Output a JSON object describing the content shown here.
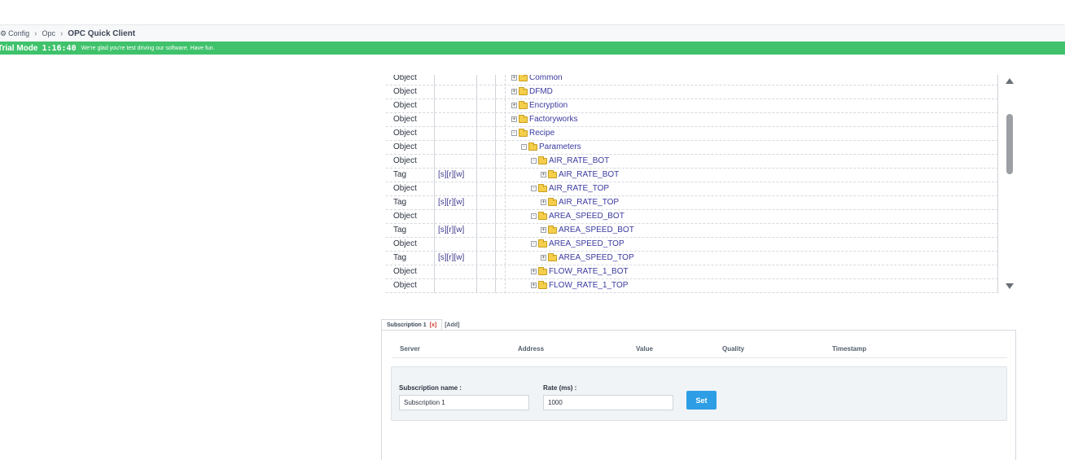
{
  "breadcrumb": {
    "items": [
      "Config",
      "Opc"
    ],
    "current": "OPC Quick Client"
  },
  "trial": {
    "mode": "Trial Mode",
    "time": "1:16:40",
    "message": "We're glad you're test driving our software. Have fun."
  },
  "tree": {
    "rows": [
      {
        "type": "Object",
        "access": "",
        "label": "Common",
        "expander": "+"
      },
      {
        "type": "Object",
        "access": "",
        "label": "DFMD",
        "expander": "+"
      },
      {
        "type": "Object",
        "access": "",
        "label": "Encryption",
        "expander": "+"
      },
      {
        "type": "Object",
        "access": "",
        "label": "Factoryworks",
        "expander": "+"
      },
      {
        "type": "Object",
        "access": "",
        "label": "Recipe",
        "expander": "-"
      },
      {
        "type": "Object",
        "access": "",
        "label": "Parameters",
        "expander": "-"
      },
      {
        "type": "Object",
        "access": "",
        "label": "AIR_RATE_BOT",
        "expander": "-"
      },
      {
        "type": "Tag",
        "access": "[s][r][w]",
        "label": "AIR_RATE_BOT",
        "expander": "+"
      },
      {
        "type": "Object",
        "access": "",
        "label": "AIR_RATE_TOP",
        "expander": "-"
      },
      {
        "type": "Tag",
        "access": "[s][r][w]",
        "label": "AIR_RATE_TOP",
        "expander": "+"
      },
      {
        "type": "Object",
        "access": "",
        "label": "AREA_SPEED_BOT",
        "expander": "-"
      },
      {
        "type": "Tag",
        "access": "[s][r][w]",
        "label": "AREA_SPEED_BOT",
        "expander": "+"
      },
      {
        "type": "Object",
        "access": "",
        "label": "AREA_SPEED_TOP",
        "expander": "-"
      },
      {
        "type": "Tag",
        "access": "[s][r][w]",
        "label": "AREA_SPEED_TOP",
        "expander": "+"
      },
      {
        "type": "Object",
        "access": "",
        "label": "FLOW_RATE_1_BOT",
        "expander": "+"
      },
      {
        "type": "Object",
        "access": "",
        "label": "FLOW_RATE_1_TOP",
        "expander": "+"
      }
    ]
  },
  "tabs": {
    "active_label": "Subscription 1",
    "close_label": "[x]",
    "add_label": "[Add]"
  },
  "grid": {
    "columns": [
      "Server",
      "Address",
      "Value",
      "Quality",
      "Timestamp"
    ]
  },
  "form": {
    "name_label": "Subscription name :",
    "name_value": "Subscription 1",
    "rate_label": "Rate (ms) :",
    "rate_value": "1000",
    "set_label": "Set"
  }
}
